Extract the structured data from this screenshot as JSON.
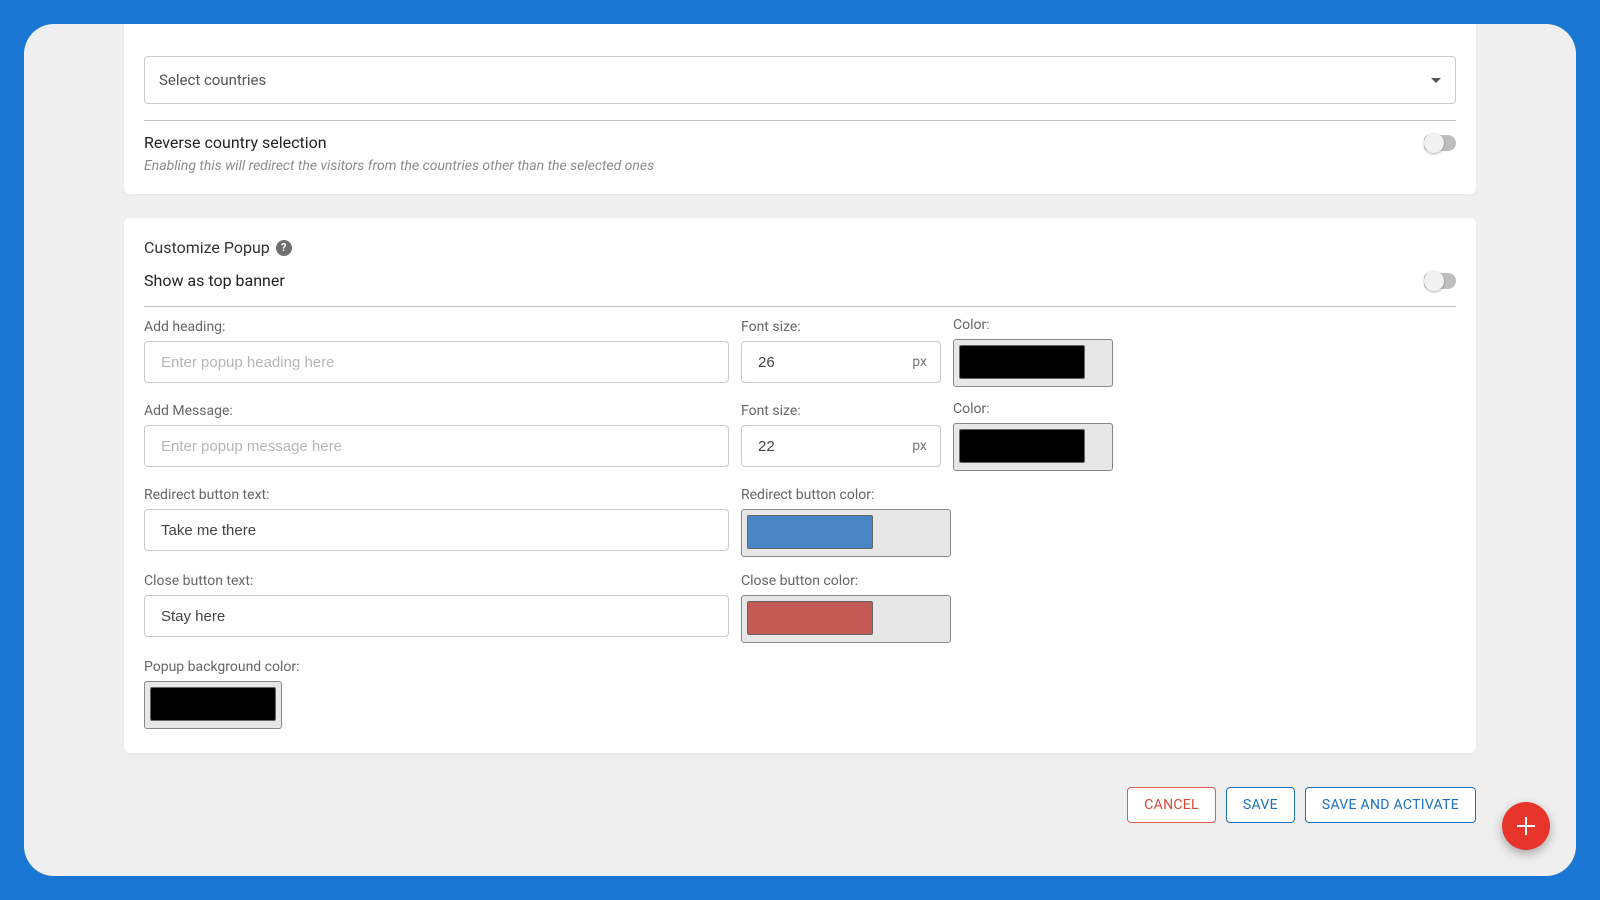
{
  "countries": {
    "placeholder": "Select countries"
  },
  "reverse": {
    "label": "Reverse country selection",
    "helper": "Enabling this will redirect the visitors from the countries other than the selected ones",
    "enabled": false
  },
  "customize": {
    "title": "Customize Popup",
    "show_banner_label": "Show as top banner",
    "show_banner_enabled": false,
    "heading": {
      "label": "Add heading:",
      "placeholder": "Enter popup heading here",
      "value": "",
      "font_label": "Font size:",
      "font_value": "26",
      "font_unit": "px",
      "color_label": "Color:",
      "color": "#000000"
    },
    "message": {
      "label": "Add Message:",
      "placeholder": "Enter popup message here",
      "value": "",
      "font_label": "Font size:",
      "font_value": "22",
      "font_unit": "px",
      "color_label": "Color:",
      "color": "#000000"
    },
    "redirect_btn": {
      "label": "Redirect button text:",
      "value": "Take me there",
      "color_label": "Redirect button color:",
      "color": "#4a85c6"
    },
    "close_btn": {
      "label": "Close button text:",
      "value": "Stay here",
      "color_label": "Close button color:",
      "color": "#c45a54"
    },
    "popup_bg": {
      "label": "Popup background color:",
      "color": "#000000"
    }
  },
  "actions": {
    "cancel": "CANCEL",
    "save": "SAVE",
    "save_activate": "SAVE AND ACTIVATE"
  }
}
